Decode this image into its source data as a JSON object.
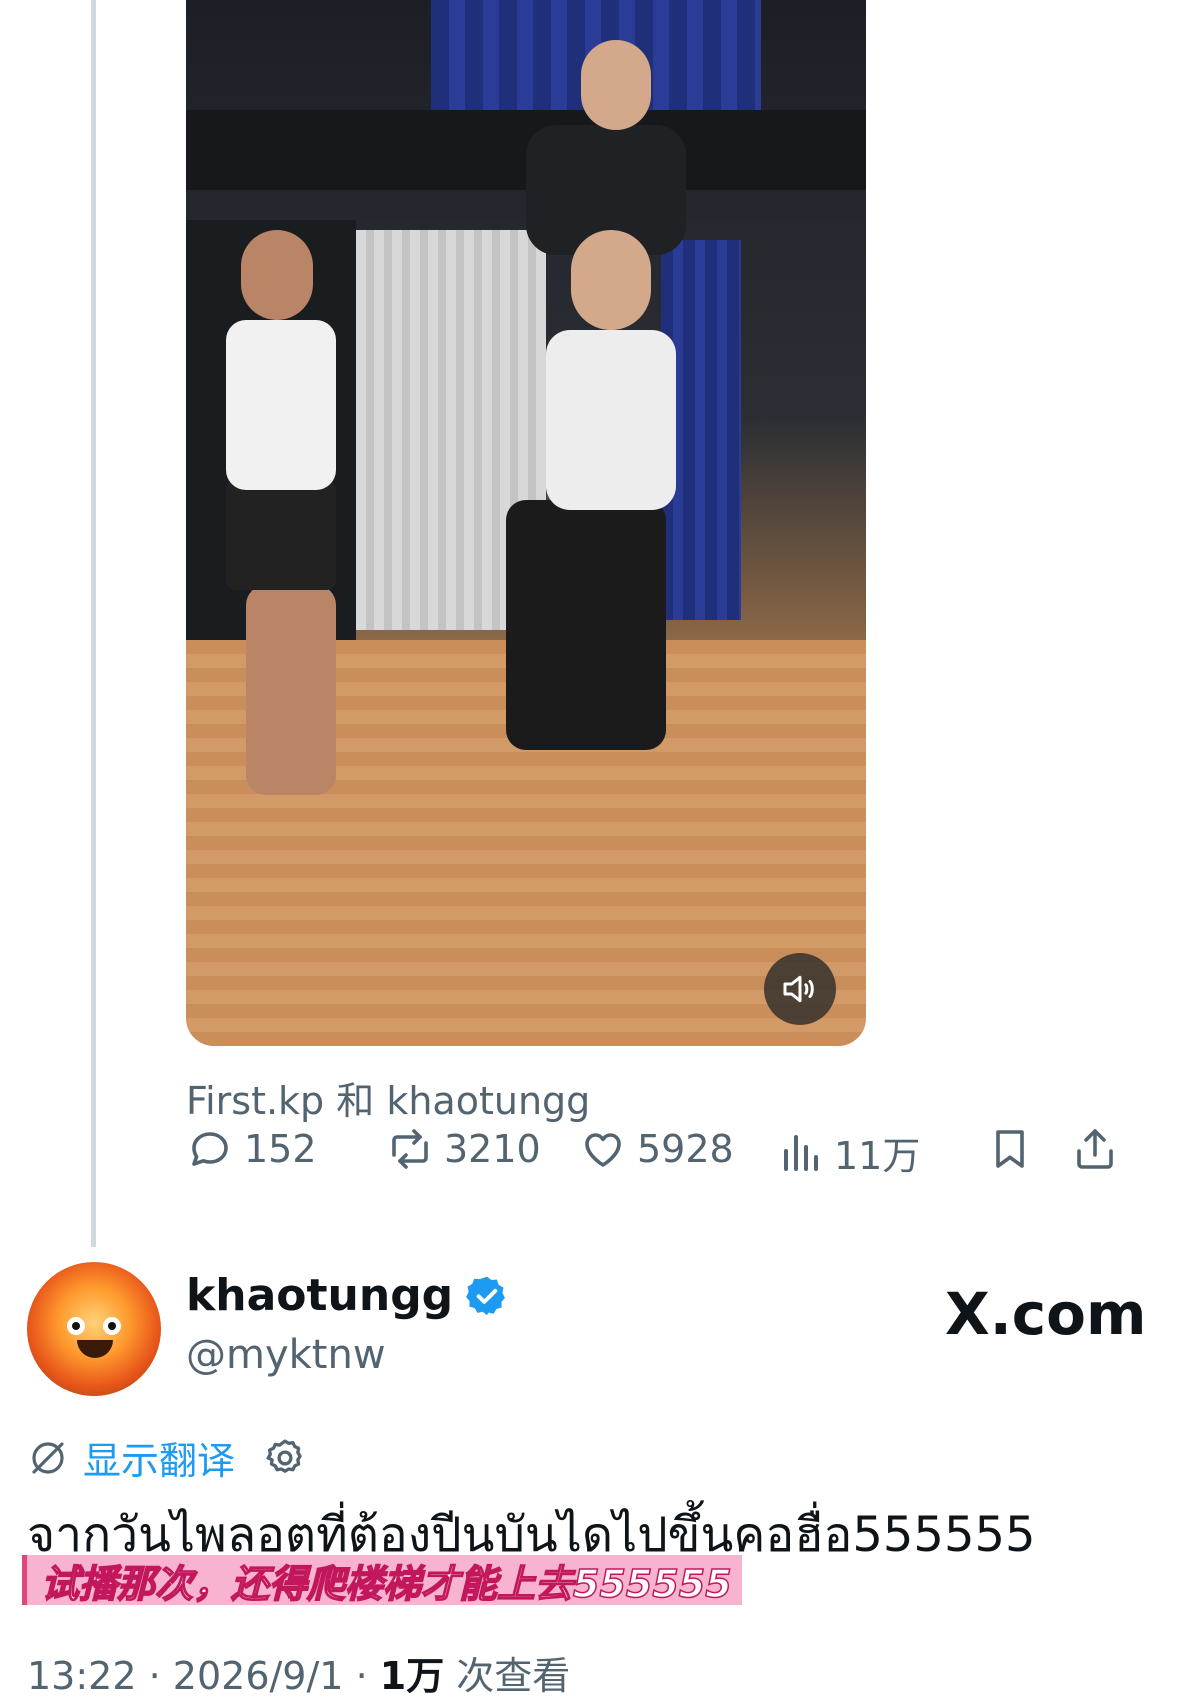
{
  "quoted_post": {
    "attribution": "First.kp 和 khaotungg",
    "stats": {
      "replies": "152",
      "reposts": "3210",
      "likes": "5928",
      "views": "11万"
    },
    "icons": [
      "reply-icon",
      "repost-icon",
      "like-icon",
      "views-icon",
      "bookmark-icon",
      "share-icon",
      "volume-icon"
    ]
  },
  "post": {
    "display_name": "khaotungg",
    "handle": "@myktnw",
    "watermark": "X.com",
    "translate_label": "显示翻译",
    "text": "จากวันไพลอตที่ต้องปีนบันไดไปขึ้นคอฮื่อ555555",
    "subtitle": "试播那次，还得爬楼梯才能上去555555",
    "time": "13:22",
    "date": "2026/9/1",
    "view_count": "1万",
    "view_label": "次查看",
    "separator": "·"
  },
  "colors": {
    "accent": "#1d9bf0",
    "secondary_text": "#536471",
    "primary_text": "#0f1419",
    "subtitle_bg": "#f7b3cf"
  }
}
